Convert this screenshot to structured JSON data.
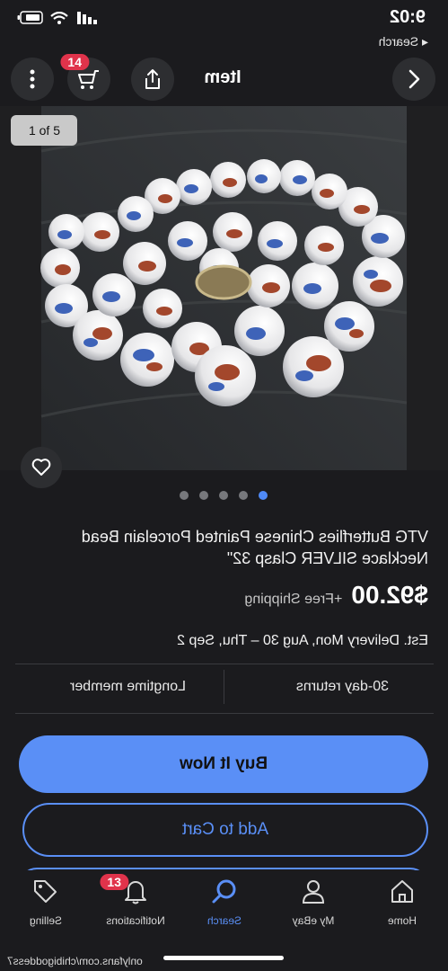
{
  "status_bar": {
    "time": "9:02",
    "back_label": "◂ Search"
  },
  "top_bar": {
    "title": "Item",
    "cart_badge": "14"
  },
  "photo": {
    "counter": "1 of 5",
    "dots_total": 5,
    "dots_active_index": 0
  },
  "listing": {
    "title": "VTG Butterflies Chinese Painted Porcelain Bead Necklace SILVER Clasp 32\"",
    "price": "$92.00",
    "shipping": "+Free Shipping",
    "delivery": "Est. Delivery Mon, Aug 30 – Thu, Sep 2",
    "features": [
      "30-day returns",
      "Longtime member"
    ]
  },
  "actions": {
    "buy_now": "Buy It Now",
    "add_to_cart": "Add to Cart"
  },
  "tab_bar": {
    "items": [
      {
        "label": "Home",
        "icon": "home-icon"
      },
      {
        "label": "My eBay",
        "icon": "person-icon"
      },
      {
        "label": "Search",
        "icon": "search-icon"
      },
      {
        "label": "Notifications",
        "icon": "bell-icon",
        "badge": "13"
      },
      {
        "label": "Selling",
        "icon": "tag-icon"
      }
    ],
    "active": "Search"
  },
  "watermark": "onlyfans.com/chibigoddess7",
  "colors": {
    "accent": "#5a8ff6",
    "badge": "#e0334b",
    "background": "#1b1b1e"
  }
}
